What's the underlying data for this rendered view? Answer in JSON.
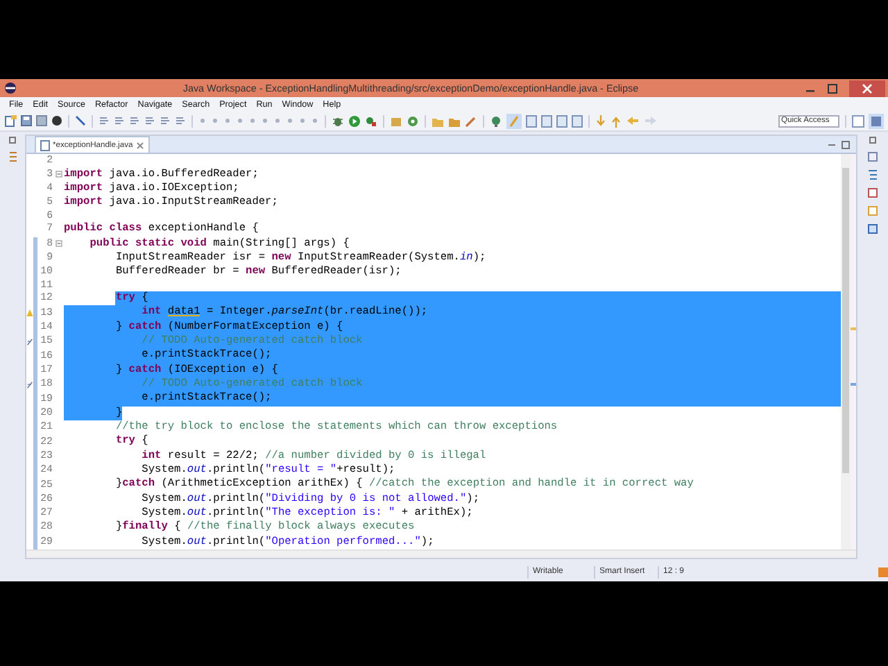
{
  "window": {
    "title": "Java Workspace - ExceptionHandlingMultithreading/src/exceptionDemo/exceptionHandle.java - Eclipse"
  },
  "menu": [
    "File",
    "Edit",
    "Source",
    "Refactor",
    "Navigate",
    "Search",
    "Project",
    "Run",
    "Window",
    "Help"
  ],
  "quick_access": {
    "placeholder": "Quick Access"
  },
  "tabs": [
    {
      "label": "*exceptionHandle.java",
      "selected": true
    }
  ],
  "editor": {
    "lines": [
      {
        "number": "2",
        "eol_selected": false,
        "range": false
      },
      {
        "number": "3",
        "selected": false,
        "eol_selected": false,
        "range": false,
        "gutter_icon": {
          "kind": "fold"
        },
        "tokens": [
          {
            "kind": "keyword",
            "text": "import"
          },
          {
            "kind": "plain",
            "text": " java.io.BufferedReader;"
          }
        ]
      },
      {
        "number": "4",
        "selected": false,
        "eol_selected": false,
        "range": false,
        "tokens": [
          {
            "kind": "keyword",
            "text": "import"
          },
          {
            "kind": "plain",
            "text": " java.io.IOException;"
          }
        ]
      },
      {
        "number": "5",
        "selected": false,
        "eol_selected": false,
        "range": false,
        "tokens": [
          {
            "kind": "keyword",
            "text": "import"
          },
          {
            "kind": "plain",
            "text": " java.io.InputStreamReader;"
          }
        ]
      },
      {
        "number": "6",
        "eol_selected": false,
        "range": false
      },
      {
        "number": "7",
        "selected": false,
        "eol_selected": false,
        "range": false,
        "tokens": [
          {
            "kind": "keyword",
            "text": "public class"
          },
          {
            "kind": "plain",
            "text": " exceptionHandle {"
          }
        ]
      },
      {
        "number": "8",
        "indent_selected": false,
        "selected": false,
        "eol_selected": false,
        "range": true,
        "gutter_icon": {
          "kind": "fold"
        },
        "tokens": [
          {
            "kind": "keyword",
            "text": "    public static void"
          },
          {
            "kind": "plain",
            "text": " main(String[] args) {"
          }
        ]
      },
      {
        "number": "9",
        "indent_selected": false,
        "selected": false,
        "eol_selected": false,
        "range": true,
        "tokens": [
          {
            "kind": "plain",
            "text": "        InputStreamReader isr = "
          },
          {
            "kind": "keyword",
            "text": "new"
          },
          {
            "kind": "plain",
            "text": " InputStreamReader(System."
          },
          {
            "kind": "field",
            "text": "in"
          },
          {
            "kind": "plain",
            "text": ");"
          }
        ]
      },
      {
        "number": "10",
        "indent_selected": false,
        "selected": false,
        "eol_selected": false,
        "range": true,
        "tokens": [
          {
            "kind": "plain",
            "text": "        BufferedReader br = "
          },
          {
            "kind": "keyword",
            "text": "new"
          },
          {
            "kind": "plain",
            "text": " BufferedReader(isr);"
          }
        ]
      },
      {
        "number": "11",
        "eol_selected": false,
        "range": true
      },
      {
        "number": "12",
        "indent_selected": false,
        "selected": true,
        "eol_selected": true,
        "range": true,
        "tokens": [
          {
            "kind": "keyword",
            "text": "        try"
          },
          {
            "kind": "plain",
            "text": " {"
          }
        ]
      },
      {
        "number": "13",
        "indent_selected": true,
        "selected": true,
        "eol_selected": true,
        "range": true,
        "gutter_icon": {
          "kind": "warning"
        },
        "tokens": [
          {
            "kind": "keyword",
            "text": "            int"
          },
          {
            "kind": "underlined",
            "text": " data1"
          },
          {
            "kind": "plain",
            "text": " = Integer."
          },
          {
            "kind": "method",
            "text": "parseInt"
          },
          {
            "kind": "plain",
            "text": "(br.readLine());"
          }
        ]
      },
      {
        "number": "14",
        "indent_selected": true,
        "selected": true,
        "eol_selected": true,
        "range": true,
        "tokens": [
          {
            "kind": "plain",
            "text": "        } "
          },
          {
            "kind": "keyword",
            "text": "catch"
          },
          {
            "kind": "plain",
            "text": " (NumberFormatException e) {"
          }
        ]
      },
      {
        "number": "15",
        "indent_selected": true,
        "selected": true,
        "eol_selected": true,
        "range": true,
        "gutter_icon": {
          "kind": "task"
        },
        "tokens": [
          {
            "kind": "comment",
            "text": "            // TODO Auto-generated catch block"
          }
        ]
      },
      {
        "number": "16",
        "indent_selected": true,
        "selected": true,
        "eol_selected": true,
        "range": true,
        "tokens": [
          {
            "kind": "plain",
            "text": "            e.printStackTrace();"
          }
        ]
      },
      {
        "number": "17",
        "indent_selected": true,
        "selected": true,
        "eol_selected": true,
        "range": true,
        "tokens": [
          {
            "kind": "plain",
            "text": "        } "
          },
          {
            "kind": "keyword",
            "text": "catch"
          },
          {
            "kind": "plain",
            "text": " (IOException e) {"
          }
        ]
      },
      {
        "number": "18",
        "indent_selected": true,
        "selected": true,
        "eol_selected": true,
        "range": true,
        "gutter_icon": {
          "kind": "task"
        },
        "tokens": [
          {
            "kind": "comment",
            "text": "            // TODO Auto-generated catch block"
          }
        ]
      },
      {
        "number": "19",
        "indent_selected": true,
        "selected": true,
        "eol_selected": true,
        "range": true,
        "tokens": [
          {
            "kind": "plain",
            "text": "            e.printStackTrace();"
          }
        ]
      },
      {
        "number": "20",
        "indent_selected": true,
        "selected": true,
        "eol_selected": false,
        "range": true,
        "tokens": [
          {
            "kind": "plain",
            "text": "        }"
          }
        ]
      },
      {
        "number": "21",
        "indent_selected": false,
        "selected": false,
        "eol_selected": false,
        "range": true,
        "tokens": [
          {
            "kind": "comment",
            "text": "        //the try block to enclose the statements which can throw exceptions"
          }
        ]
      },
      {
        "number": "22",
        "indent_selected": false,
        "selected": false,
        "eol_selected": false,
        "range": true,
        "tokens": [
          {
            "kind": "keyword",
            "text": "        try"
          },
          {
            "kind": "plain",
            "text": " {"
          }
        ]
      },
      {
        "number": "23",
        "indent_selected": false,
        "selected": false,
        "eol_selected": false,
        "range": true,
        "tokens": [
          {
            "kind": "keyword",
            "text": "            int"
          },
          {
            "kind": "plain",
            "text": " result = 22/2; "
          },
          {
            "kind": "comment",
            "text": "//a number divided by 0 is illegal"
          }
        ]
      },
      {
        "number": "24",
        "indent_selected": false,
        "selected": false,
        "eol_selected": false,
        "range": true,
        "tokens": [
          {
            "kind": "plain",
            "text": "            System."
          },
          {
            "kind": "field",
            "text": "out"
          },
          {
            "kind": "plain",
            "text": ".println("
          },
          {
            "kind": "string",
            "text": "\"result = \""
          },
          {
            "kind": "plain",
            "text": "+result);"
          }
        ]
      },
      {
        "number": "25",
        "indent_selected": false,
        "selected": false,
        "eol_selected": false,
        "range": true,
        "tokens": [
          {
            "kind": "plain",
            "text": "        }"
          },
          {
            "kind": "keyword",
            "text": "catch"
          },
          {
            "kind": "plain",
            "text": " (ArithmeticException arithEx) { "
          },
          {
            "kind": "comment",
            "text": "//catch the exception and handle it in correct way"
          }
        ]
      },
      {
        "number": "26",
        "indent_selected": false,
        "selected": false,
        "eol_selected": false,
        "range": true,
        "tokens": [
          {
            "kind": "plain",
            "text": "            System."
          },
          {
            "kind": "field",
            "text": "out"
          },
          {
            "kind": "plain",
            "text": ".println("
          },
          {
            "kind": "string",
            "text": "\"Dividing by 0 is not allowed.\""
          },
          {
            "kind": "plain",
            "text": ");"
          }
        ]
      },
      {
        "number": "27",
        "indent_selected": false,
        "selected": false,
        "eol_selected": false,
        "range": true,
        "tokens": [
          {
            "kind": "plain",
            "text": "            System."
          },
          {
            "kind": "field",
            "text": "out"
          },
          {
            "kind": "plain",
            "text": ".println("
          },
          {
            "kind": "string",
            "text": "\"The exception is: \""
          },
          {
            "kind": "plain",
            "text": " + arithEx);"
          }
        ]
      },
      {
        "number": "28",
        "indent_selected": false,
        "selected": false,
        "eol_selected": false,
        "range": true,
        "tokens": [
          {
            "kind": "plain",
            "text": "        }"
          },
          {
            "kind": "keyword",
            "text": "finally"
          },
          {
            "kind": "plain",
            "text": " { "
          },
          {
            "kind": "comment",
            "text": "//the finally block always executes"
          }
        ]
      },
      {
        "number": "29",
        "indent_selected": false,
        "selected": false,
        "eol_selected": false,
        "range": true,
        "tokens": [
          {
            "kind": "plain",
            "text": "            System."
          },
          {
            "kind": "field",
            "text": "out"
          },
          {
            "kind": "plain",
            "text": ".println("
          },
          {
            "kind": "string",
            "text": "\"Operation performed...\""
          },
          {
            "kind": "plain",
            "text": ");"
          }
        ]
      }
    ]
  },
  "status_bar": {
    "mode": "Writable",
    "insert": "Smart Insert",
    "position": "12 : 9"
  }
}
